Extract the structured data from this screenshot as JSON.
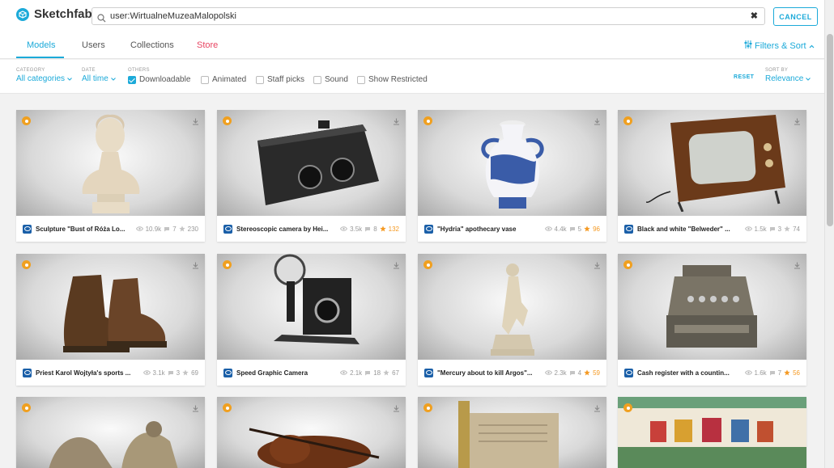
{
  "header": {
    "brand": "Sketchfab",
    "search_value": "user:WirtualneMuzeaMalopolski",
    "clear_symbol": "✖",
    "cancel_label": "CANCEL"
  },
  "tabs": [
    {
      "label": "Models"
    },
    {
      "label": "Users"
    },
    {
      "label": "Collections"
    },
    {
      "label": "Store"
    }
  ],
  "filters_sort_label": "Filters & Sort",
  "filters": {
    "category": {
      "label": "CATEGORY",
      "value": "All categories"
    },
    "date": {
      "label": "DATE",
      "value": "All time"
    },
    "others_label": "OTHERS",
    "downloadable": "Downloadable",
    "animated": "Animated",
    "staff_picks": "Staff picks",
    "sound": "Sound",
    "show_restricted": "Show Restricted",
    "reset": "RESET",
    "sort": {
      "label": "SORT BY",
      "value": "Relevance"
    }
  },
  "cards": [
    {
      "title": "Sculpture \"Bust of Róża Lo...",
      "views": "10.9k",
      "comments": "7",
      "likes": "230",
      "hot": false
    },
    {
      "title": "Stereoscopic camera by Hei...",
      "views": "3.5k",
      "comments": "8",
      "likes": "132",
      "hot": true
    },
    {
      "title": "\"Hydria\" apothecary vase",
      "views": "4.4k",
      "comments": "5",
      "likes": "96",
      "hot": true
    },
    {
      "title": "Black and white \"Belweder\" ...",
      "views": "1.5k",
      "comments": "3",
      "likes": "74",
      "hot": false
    },
    {
      "title": "Priest Karol Wojtyła's sports ...",
      "views": "3.1k",
      "comments": "3",
      "likes": "69",
      "hot": false
    },
    {
      "title": "Speed Graphic Camera",
      "views": "2.1k",
      "comments": "18",
      "likes": "67",
      "hot": false
    },
    {
      "title": "\"Mercury about to kill Argos\"...",
      "views": "2.3k",
      "comments": "4",
      "likes": "59",
      "hot": true
    },
    {
      "title": "Cash register with a countin...",
      "views": "1.6k",
      "comments": "7",
      "likes": "56",
      "hot": true
    }
  ],
  "colors": {
    "accent": "#1caad9",
    "store": "#e84562",
    "staff_pick": "#f0a020",
    "hot_likes": "#f59a23"
  }
}
